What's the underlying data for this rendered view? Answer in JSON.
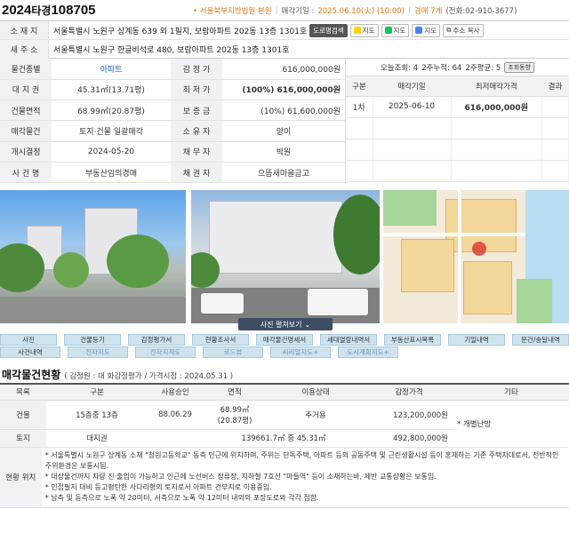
{
  "header": {
    "case_year": "2024",
    "case_type": "타경",
    "case_num": "108705",
    "court": "서울북부지방법원 본원",
    "sale_date_label": "매각기일 :",
    "sale_date": "2025.06.10(火) (10:00)",
    "dept": "경매 7계",
    "phone": "(전화:02-910-3677)"
  },
  "address": {
    "label1": "소 재 지",
    "value1": "서울특별시 노원구 상계동 639 외 1필지, 보람아파트 202동 13층 1301호",
    "label2": "새 주 소",
    "value2": "서울특별시 노원구 한글비석로 480, 보람아파트 202동 13층 1301호",
    "buttons": [
      "도로명검색",
      "지도",
      "지도",
      "지도",
      "주소 복사"
    ]
  },
  "info_rows": [
    {
      "l1": "물건종별",
      "v1": "아파트",
      "l2": "감 정 가",
      "v2": "616,000,000원"
    },
    {
      "l1": "대 지 권",
      "v1": "45.31㎡(13.71평)",
      "l2": "최 저 가",
      "v2": "(100%) 616,000,000원"
    },
    {
      "l1": "건물면적",
      "v1": "68.99㎡(20.87평)",
      "l2": "보 증 금",
      "v2": "(10%) 61,600,000원"
    },
    {
      "l1": "매각물건",
      "v1": "토지·건물 일괄매각",
      "l2": "소 유 자",
      "v2": "양이"
    },
    {
      "l1": "개시결정",
      "v1": "2024-05-20",
      "l2": "채 무 자",
      "v2": "박원"
    },
    {
      "l1": "사 건 명",
      "v1": "부동산임의경매",
      "l2": "채 권 자",
      "v2": "으뜸새마을금고"
    }
  ],
  "views": {
    "today": "오늘조회: 4",
    "two_week": "2주누적: 64",
    "avg": "2주평균: 5",
    "btn": "조회동향"
  },
  "sale_table": {
    "headers": [
      "구분",
      "매각기일",
      "최저매각가격",
      "결과"
    ],
    "rows": [
      [
        "1차",
        "2025-06-10",
        "616,000,000원",
        ""
      ]
    ]
  },
  "photo_button": "사진 펼쳐보기",
  "nav_row1": [
    "사진",
    "건물등기",
    "감정평가서",
    "현황조사서",
    "매각물건명세서",
    "세대열람내역서",
    "부동산표시목록",
    "기일내역",
    "문건/송달내역"
  ],
  "nav_row2": [
    "사건내역",
    "전자지도",
    "전자지적도",
    "로드뷰",
    "씨리얼지도+",
    "도시계획지도+"
  ],
  "section": {
    "title": "매각물건현황",
    "sub": "( 감정원 : 대 화감정평가 / 가격시점 : 2024.05.31 )"
  },
  "bottom_table": {
    "headers": [
      "목록",
      "구분",
      "사용승인",
      "면적",
      "이용상태",
      "감정가격",
      "기타"
    ],
    "building": {
      "label": "건물",
      "kind": "15층중 13층",
      "approval": "88.06.29",
      "area1": "68.99㎡",
      "area2": "(20.87평)",
      "use": "주거용",
      "price": "123,200,000원"
    },
    "etc": "* 개별난방",
    "land": {
      "label": "토지",
      "kind": "대지권",
      "area": "139661.7㎡ 중 45.31㎡",
      "price": "492,800,000원"
    }
  },
  "location": {
    "label": "현황 위치",
    "lines": [
      "* 서울특별시 노원구 상계동 소재 \"청원고등학교\" 동측 인근에 위치하며, 주위는 단독주택, 아파트 등의 공동주택 및 근린생활시설 등이 혼재하는 기존 주택지대로서, 전반적인 주위환경은 보통시됨.",
      "* 대상물건까지 차량 진·출입이 가능하고 인근에 노선버스 정류장, 지하철 7호선 \"마들역\" 등이 소재하는바, 제반 교통상황은 보통임.",
      "* 인접필지 대비 등고평탄한 사다리형의 토지로서 아파트 건부지로 이용중임.",
      "* 남측 및 동측으로 노폭 약 20미터, 서측으로 노폭 약 12미터 내외의 포장도로와 각각 접함."
    ]
  }
}
